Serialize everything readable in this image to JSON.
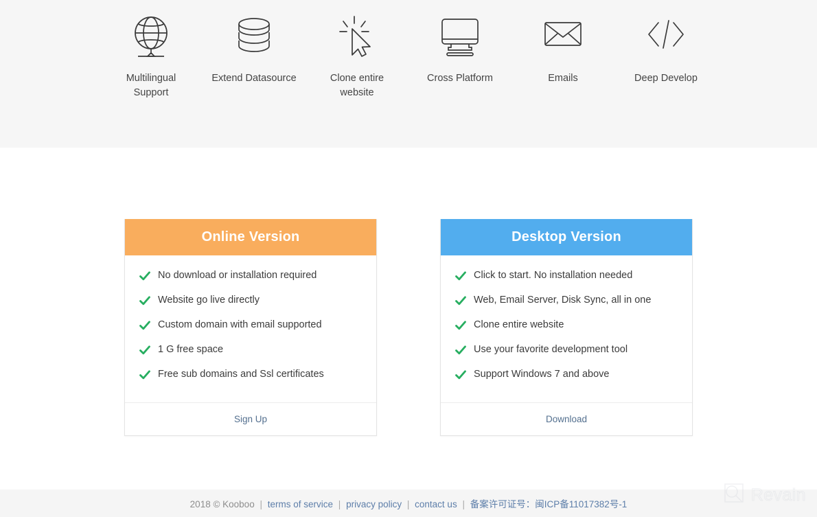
{
  "features": {
    "items": [
      {
        "icon": "globe-icon",
        "label": "Multilingual Support"
      },
      {
        "icon": "database-icon",
        "label": "Extend Datasource"
      },
      {
        "icon": "click-cursor-icon",
        "label": "Clone entire website"
      },
      {
        "icon": "monitor-icon",
        "label": "Cross Platform"
      },
      {
        "icon": "envelope-icon",
        "label": "Emails"
      },
      {
        "icon": "code-brackets-icon",
        "label": "Deep Develop"
      }
    ]
  },
  "pricing": {
    "cards": [
      {
        "title": "Online Version",
        "accent": "#f9ad5d",
        "features": [
          "No download or installation required",
          "Website go live directly",
          "Custom domain with email supported",
          "1 G free space",
          "Free sub domains and Ssl certificates"
        ],
        "cta": "Sign Up"
      },
      {
        "title": "Desktop Version",
        "accent": "#52adee",
        "features": [
          "Click to start. No installation needed",
          "Web, Email Server, Disk Sync, all in one",
          "Clone entire website",
          "Use your favorite development tool",
          "Support Windows 7 and above"
        ],
        "cta": "Download"
      }
    ],
    "check_color": "#27ae60"
  },
  "footer": {
    "copyright": "2018 © Kooboo",
    "links": [
      "terms of service",
      "privacy policy",
      "contact us"
    ],
    "icp": "备案许可证号：闽ICP备11017382号-1",
    "separator": "|"
  },
  "watermark": {
    "text": "Revain",
    "icon": "revain-logo-icon"
  }
}
